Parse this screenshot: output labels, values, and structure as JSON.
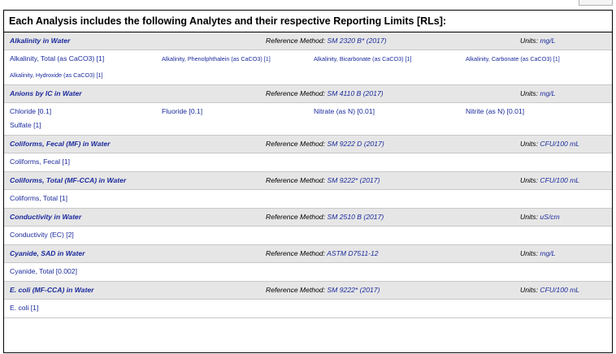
{
  "heading": "Each Analysis includes the following Analytes and their respective Reporting Limits [RLs]:",
  "labels": {
    "reference_method": "Reference Method: ",
    "units": "Units: "
  },
  "sections": [
    {
      "title": "Alkalinity in Water",
      "method": "SM 2320 B* (2017)",
      "units": "mg/L",
      "rows": [
        [
          "Alkalinity, Total (as CaCO3) [1]",
          "Alkalinity, Phenolphthalein (as CaCO3) [1]",
          "Alkalinity, Bicarbonate (as CaCO3) [1]",
          "Alkalinity, Carbonate (as CaCO3) [1]"
        ],
        [
          "Alkalinity, Hydroxide (as CaCO3) [1]"
        ]
      ]
    },
    {
      "title": "Anions by IC in Water",
      "method": "SM 4110 B (2017)",
      "units": "mg/L",
      "rows": [
        [
          "Chloride [0.1]",
          "Fluoride [0.1]",
          "Nitrate (as N) [0.01]",
          "Nitrite (as N) [0.01]"
        ],
        [
          "Sulfate [1]"
        ]
      ]
    },
    {
      "title": "Coliforms, Fecal (MF) in Water",
      "method": "SM 9222 D (2017)",
      "units": "CFU/100 mL",
      "rows": [
        [
          "Coliforms, Fecal [1]"
        ]
      ]
    },
    {
      "title": "Coliforms, Total (MF-CCA) in Water",
      "method": "SM 9222* (2017)",
      "units": "CFU/100 mL",
      "rows": [
        [
          "Coliforms, Total [1]"
        ]
      ]
    },
    {
      "title": "Conductivity in Water",
      "method": "SM 2510 B (2017)",
      "units": "uS/cm",
      "rows": [
        [
          "Conductivity (EC) [2]"
        ]
      ]
    },
    {
      "title": "Cyanide, SAD in Water",
      "method": "ASTM D7511-12",
      "units": "mg/L",
      "rows": [
        [
          "Cyanide, Total [0.002]"
        ]
      ]
    },
    {
      "title": "E. coli (MF-CCA) in Water",
      "method": "SM 9222* (2017)",
      "units": "CFU/100 mL",
      "rows": [
        [
          "E. coli [1]"
        ]
      ]
    }
  ]
}
